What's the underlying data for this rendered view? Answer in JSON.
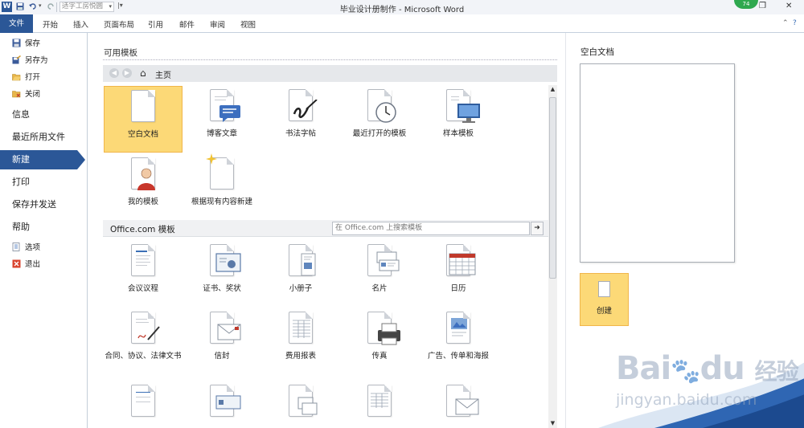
{
  "title_bar": {
    "app_icon": "W",
    "qat_combo_value": "适字工房悦圆",
    "window_title": "毕业设计册制作 - Microsoft Word",
    "badge_count": "74",
    "minimize_icon": "minimize-icon",
    "restore_icon": "restore-icon",
    "close_icon": "close-icon"
  },
  "ribbon_tabs": {
    "file": "文件",
    "items": [
      "开始",
      "插入",
      "页面布局",
      "引用",
      "邮件",
      "审阅",
      "视图"
    ]
  },
  "left_nav": {
    "save": "保存",
    "save_as": "另存为",
    "open": "打开",
    "close": "关闭",
    "info": "信息",
    "recent": "最近所用文件",
    "new": "新建",
    "print": "打印",
    "save_send": "保存并发送",
    "help": "帮助",
    "options": "选项",
    "exit": "退出",
    "active_item": "新建"
  },
  "available_templates": {
    "title": "可用模板",
    "nav_home": "主页",
    "tiles": [
      {
        "label": "空白文档",
        "icon": "blank-document-icon",
        "selected": true
      },
      {
        "label": "博客文章",
        "icon": "blog-post-icon"
      },
      {
        "label": "书法字帖",
        "icon": "calligraphy-icon"
      },
      {
        "label": "最近打开的模板",
        "icon": "recent-templates-icon"
      },
      {
        "label": "样本模板",
        "icon": "sample-templates-icon"
      },
      {
        "label": "我的模板",
        "icon": "my-templates-icon"
      },
      {
        "label": "根据现有内容新建",
        "icon": "new-from-existing-icon"
      }
    ]
  },
  "office_templates": {
    "title": "Office.com 模板",
    "search_placeholder": "在 Office.com 上搜索模板",
    "tiles": [
      {
        "label": "会议议程",
        "icon": "agenda-icon"
      },
      {
        "label": "证书、奖状",
        "icon": "certificate-icon"
      },
      {
        "label": "小册子",
        "icon": "brochure-icon"
      },
      {
        "label": "名片",
        "icon": "business-card-icon"
      },
      {
        "label": "日历",
        "icon": "calendar-icon"
      },
      {
        "label": "合同、协议、法律文书",
        "icon": "contract-icon"
      },
      {
        "label": "信封",
        "icon": "envelope-icon"
      },
      {
        "label": "费用报表",
        "icon": "expense-report-icon"
      },
      {
        "label": "传真",
        "icon": "fax-icon"
      },
      {
        "label": "广告、传单和海报",
        "icon": "flyer-icon"
      }
    ]
  },
  "right_panel": {
    "preview_title": "空白文档",
    "create_label": "创建"
  },
  "watermark": {
    "brand": "Bai",
    "brand2": "du",
    "cn": "经验",
    "url": "jingyan.baidu.com"
  },
  "colors": {
    "accent": "#2b5797",
    "selection": "#fcd977",
    "selection_border": "#f0b54a",
    "badge": "#2fa84f"
  }
}
